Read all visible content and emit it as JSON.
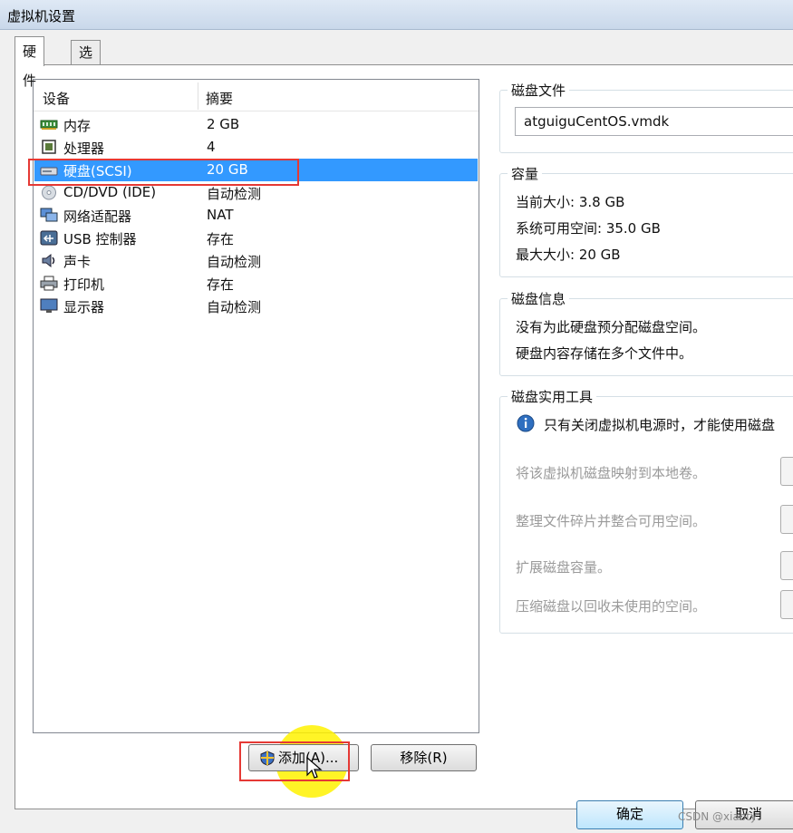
{
  "window": {
    "title": "虚拟机设置"
  },
  "tabs": [
    {
      "label": "硬件",
      "active": true
    },
    {
      "label": "选项",
      "active": false
    }
  ],
  "device_list": {
    "headers": {
      "device": "设备",
      "summary": "摘要"
    },
    "rows": [
      {
        "name": "内存",
        "summary": "2 GB",
        "icon": "memory-icon"
      },
      {
        "name": "处理器",
        "summary": "4",
        "icon": "processor-icon"
      },
      {
        "name": "硬盘(SCSI)",
        "summary": "20 GB",
        "icon": "hard-disk-icon",
        "selected": true
      },
      {
        "name": "CD/DVD (IDE)",
        "summary": "自动检测",
        "icon": "cd-dvd-icon"
      },
      {
        "name": "网络适配器",
        "summary": "NAT",
        "icon": "network-adapter-icon"
      },
      {
        "name": "USB 控制器",
        "summary": "存在",
        "icon": "usb-icon"
      },
      {
        "name": "声卡",
        "summary": "自动检测",
        "icon": "sound-card-icon"
      },
      {
        "name": "打印机",
        "summary": "存在",
        "icon": "printer-icon"
      },
      {
        "name": "显示器",
        "summary": "自动检测",
        "icon": "display-icon"
      }
    ]
  },
  "buttons": {
    "add": "添加(A)...",
    "remove": "移除(R)",
    "ok": "确定",
    "cancel": "取消"
  },
  "disk_file": {
    "title": "磁盘文件",
    "value": "atguiguCentOS.vmdk"
  },
  "capacity": {
    "title": "容量",
    "current": "当前大小: 3.8 GB",
    "available": "系统可用空间: 35.0 GB",
    "max": "最大大小: 20 GB"
  },
  "disk_info": {
    "title": "磁盘信息",
    "line1": "没有为此硬盘预分配磁盘空间。",
    "line2": "硬盘内容存储在多个文件中。"
  },
  "disk_utilities": {
    "title": "磁盘实用工具",
    "note": "只有关闭虚拟机电源时，才能使用磁盘",
    "items": [
      "将该虚拟机磁盘映射到本地卷。",
      "整理文件碎片并整合可用空间。",
      "扩展磁盘容量。",
      "压缩磁盘以回收未使用的空间。"
    ]
  },
  "watermark": "CSDN @xiaoty"
}
